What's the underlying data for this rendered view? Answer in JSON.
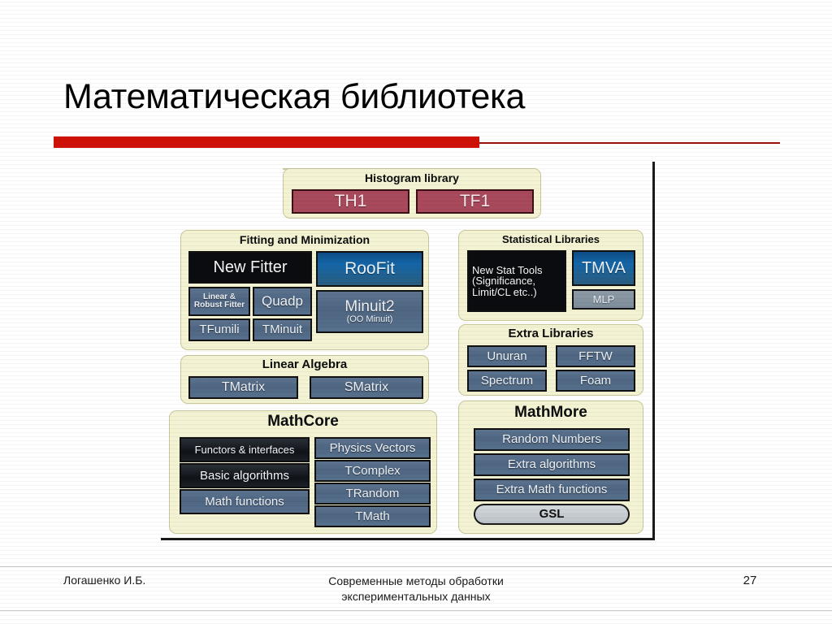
{
  "slide": {
    "title": "Математическая библиотека",
    "accent_color": "#cf1208",
    "panel_color": "#f3f2d3"
  },
  "diagram": {
    "groups": {
      "histogram": {
        "title": "Histogram library",
        "nodes": [
          {
            "label": "TH1",
            "style": "red"
          },
          {
            "label": "TF1",
            "style": "red"
          }
        ]
      },
      "fitting": {
        "title": "Fitting and Minimization",
        "nodes": [
          {
            "label": "New Fitter",
            "style": "black"
          },
          {
            "label": "RooFit",
            "style": "blue"
          },
          {
            "label": "Linear &",
            "label2": "Robust Fitter",
            "style": "steel"
          },
          {
            "label": "Quadp",
            "style": "steel"
          },
          {
            "label": "Minuit2",
            "label2": "(OO Minuit)",
            "style": "steel"
          },
          {
            "label": "TFumili",
            "style": "steel"
          },
          {
            "label": "TMinuit",
            "style": "steel"
          }
        ]
      },
      "linear_algebra": {
        "title": "Linear Algebra",
        "nodes": [
          {
            "label": "TMatrix",
            "style": "steel"
          },
          {
            "label": "SMatrix",
            "style": "steel"
          }
        ]
      },
      "mathcore": {
        "title": "MathCore",
        "nodes": [
          {
            "label": "Functors & interfaces",
            "style": "dark"
          },
          {
            "label": "Basic algorithms",
            "style": "dark"
          },
          {
            "label": "Math functions",
            "style": "steel"
          },
          {
            "label": "Physics Vectors",
            "style": "steel"
          },
          {
            "label": "TComplex",
            "style": "steel"
          },
          {
            "label": "TRandom",
            "style": "steel"
          },
          {
            "label": "TMath",
            "style": "steel"
          }
        ]
      },
      "statistical": {
        "title": "Statistical Libraries",
        "nodes": [
          {
            "label": "New Stat Tools",
            "label2": "(Significance,",
            "label3": "Limit/CL etc..)",
            "style": "black"
          },
          {
            "label": "TMVA",
            "style": "blue"
          },
          {
            "label": "MLP",
            "style": "steel-light"
          }
        ]
      },
      "extra": {
        "title": "Extra Libraries",
        "nodes": [
          {
            "label": "Unuran",
            "style": "steel"
          },
          {
            "label": "FFTW",
            "style": "steel"
          },
          {
            "label": "Spectrum",
            "style": "steel"
          },
          {
            "label": "Foam",
            "style": "steel"
          }
        ]
      },
      "mathmore": {
        "title": "MathMore",
        "nodes": [
          {
            "label": "Random Numbers",
            "style": "steel"
          },
          {
            "label": "Extra algorithms",
            "style": "steel"
          },
          {
            "label": "Extra Math functions",
            "style": "steel"
          },
          {
            "label": "GSL",
            "style": "gsl"
          }
        ]
      }
    }
  },
  "footer": {
    "author": "Логашенко И.Б.",
    "center_line1": "Современные методы обработки",
    "center_line2": "экспериментальных данных",
    "page": "27"
  }
}
